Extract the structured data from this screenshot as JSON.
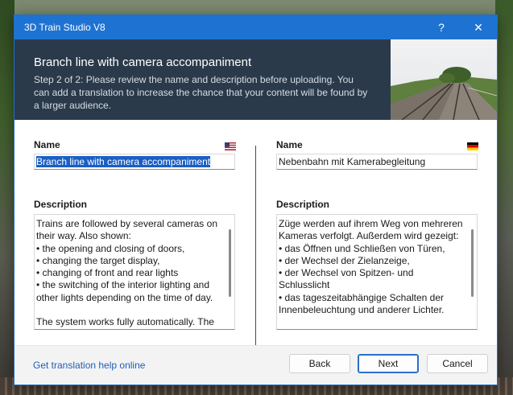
{
  "window": {
    "title": "3D Train Studio V8",
    "help": "?",
    "close": "✕"
  },
  "header": {
    "title": "Branch line with camera accompaniment",
    "description": "Step 2 of 2: Please review the name and description before uploading. You can add a translation to increase the chance that your content will be found by a larger audience."
  },
  "left": {
    "name_label": "Name",
    "language_flag": "us-flag-icon",
    "name_value": "Branch line with camera accompaniment",
    "description_label": "Description",
    "description_value": "Trains are followed by several cameras on their way. Also shown:\n• the opening and closing of doors,\n• changing the target display,\n• changing of front and rear lights\n• the switching of the interior lighting and other lights depending on the time of day.\n\nThe system works fully automatically. The"
  },
  "right": {
    "name_label": "Name",
    "language_flag": "de-flag-icon",
    "name_value": "Nebenbahn mit Kamerabegleitung",
    "description_label": "Description",
    "description_value": "Züge werden auf ihrem Weg von mehreren Kameras verfolgt. Außerdem wird gezeigt:\n• das Öffnen und Schließen von Türen,\n• der Wechsel der Zielanzeige,\n• der Wechsel von Spitzen- und Schlusslicht\n• das tageszeitabhängige Schalten der Innenbeleuchtung und anderer Lichter."
  },
  "footer": {
    "help_link": "Get translation help online",
    "back": "Back",
    "next": "Next",
    "cancel": "Cancel"
  },
  "colors": {
    "accent": "#1e73d2",
    "header_bg": "#2b3a4a",
    "link": "#1f5fb6"
  }
}
